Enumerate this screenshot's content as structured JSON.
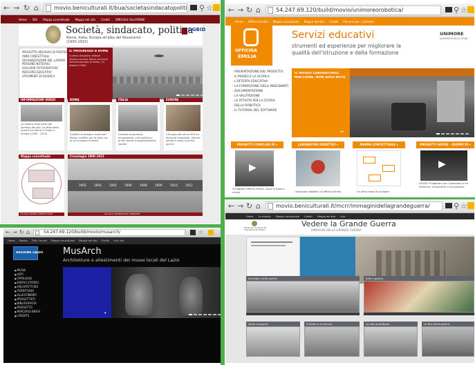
{
  "q1": {
    "url": "movio.beniculturali.it/bua/societasindacatopolitica/",
    "nav": [
      "Home",
      "Stili",
      "Mappa concettuale",
      "Mappa del sito",
      "Crediti",
      "SPECIALE ALLUVIONE"
    ],
    "title": "Società, sindacato, politica",
    "subtitle_line1": "Roma, Italia, Europa all'alba del Novecento",
    "subtitle_line2": "(1900-1915)",
    "brand": "DGBID",
    "menu": [
      "PROGETTO ARCHIVIO DI POSTAZIONE",
      "ANNI CONCETTUALI",
      "ORGANIZZAZIONI DEL LAVORO",
      "PERSONE NOTEVOLI",
      "GALLERIE FOTOGRAFICHE",
      "PERCORSI EDUCATIVI",
      "STRUMENTI DI RICERCA"
    ],
    "feature_title": "IL PROGRESSO A ROMA",
    "feature_text": "Il primo dirigibile militare italiano sorvola Roma (Archivio dell'Ambasciata di Roma, 31 ottobre 1908)",
    "cards": [
      {
        "title": "INFORMAZIONI VERSO",
        "text": "La mostra nella parte del Archivio del sito. Le sfide della ricerca tra Roma e l'Italia in Europa (1900 - 1915)"
      },
      {
        "title": "ROMA",
        "text": "Conflitti di strada e cortei per Roma, conflitti con le città, tra le vie e piazze di Roma"
      },
      {
        "title": "ITALIA",
        "text": "Crescita economica, emigrazione, crisi politica e prime forme di organizzazione sociale"
      },
      {
        "title": "EUROPA",
        "text": "L'Europa del primo 900 fra fermenti industriali, riforme sociali e verso la prima guerra"
      }
    ],
    "map_title": "Mappa concettuale",
    "map_link": "VAI ALLA MAPPA CONCETTUALE",
    "timeline_title": "Cronologia 1900-1915",
    "timeline_years": [
      "1902",
      "1903",
      "1905",
      "1906",
      "1908",
      "1909",
      "1910",
      "1912"
    ],
    "timeline_link": "VAI ALLA CRONOLOGIA COMPLETA"
  },
  "q2": {
    "url": "54.247.69.120/build/movio/unimoreorobotica/",
    "nav": [
      "Home",
      "Officina Emilia",
      "Mappa concettuale",
      "Mappa del sito",
      "Crediti",
      "Percorsi per i visitatori"
    ],
    "logo_line1": "OFFICINA",
    "logo_line2": "EMILIA",
    "title": "Servizi educativi",
    "subtitle_line1": "strumenti ed esperienze per migliorare la",
    "subtitle_line2": "qualità dell'istruzione e della formazione",
    "brand": "UNIMORE",
    "brand_sub": "UNIVERSITÀ DEGLI STUDI",
    "menu": [
      "PRESENTAZIONE DEL PROGETTO",
      "IL MUSEO E LA SCUOLA",
      "L'OFFERTA EDUCATIVA",
      "LA FORMAZIONE DEGLI INSEGNANTI",
      "DOCUMENTAZIONE",
      "LA VALUTAZIONE",
      "LE ATTIVITÀ PER LA STORIA",
      "DELLA ROBOTICA",
      "IL TUTORIAL DEL SOFTWARE"
    ],
    "feature_title_1": "IL MUSEO LABORATORIO,",
    "feature_title_2": "MACCHINE, NON SOLO AUTO",
    "blocks": [
      {
        "title": "PROGETTI CONCLUSI DI",
        "text": "Il progetto Officina Emilia, come si trova e vivere"
      },
      {
        "title": "LABORATORI DIDATTICI",
        "text": "I laboratori didattici di Officina Emilia"
      },
      {
        "title": "MAPPA CONCETTUALE",
        "text": "Un altro modo di navigare"
      },
      {
        "title": "PROGETTI HOUSE - ESEMPI DI",
        "text": "HOUSE: Progettare per i laboratori e tra memoria, conoscenza e innovazione"
      }
    ]
  },
  "q3": {
    "url": "54.247.69.120/build/movio/musarch/",
    "nav": [
      "Home",
      "Mostra",
      "Tutti i musei",
      "Mappa concettuale",
      "Mappa del sito",
      "Crediti",
      "Link utili"
    ],
    "logo_text": "REGIONE LAZIO",
    "title": "MusArch",
    "subtitle": "Architetture e allestimenti dei musei locali del Lazio",
    "menu": [
      "MUSEI",
      "ARTI",
      "TIPOLOGIE",
      "EDIFICI STORICI",
      "ARCHITETTURE",
      "TERRITORIO",
      "ALLESTIMENTI",
      "PROGETTISTI",
      "BIBLIOGRAFIA",
      "PROGETTO",
      "PERCORSI BREVI",
      "CREDITS"
    ]
  },
  "q4": {
    "url": "movio.beniculturali.it/mcrr/immaginidellagrandeguerra/",
    "nav": [
      "Home",
      "La mostra",
      "Mappa concettuale",
      "Crediti",
      "Mappa del sito",
      "Link"
    ],
    "institution": "Istituto per la Storia del Risorgimento Italiano",
    "title": "Vedere la Grande Guerra",
    "subtitle": "IMMAGINI DELLA GRANDE GUERRA",
    "sections": [
      "Immagini della guerra",
      "Arte e guerra",
      "Verso la guerra",
      "Il fronte e le trincee",
      "La vita quotidiana",
      "La fine della guerra"
    ]
  },
  "colors": {
    "q1_red": "#7c0f14",
    "q2_orange": "#f08a00",
    "q3_blue": "#1b1fa3",
    "divider_green": "#4caf50"
  }
}
